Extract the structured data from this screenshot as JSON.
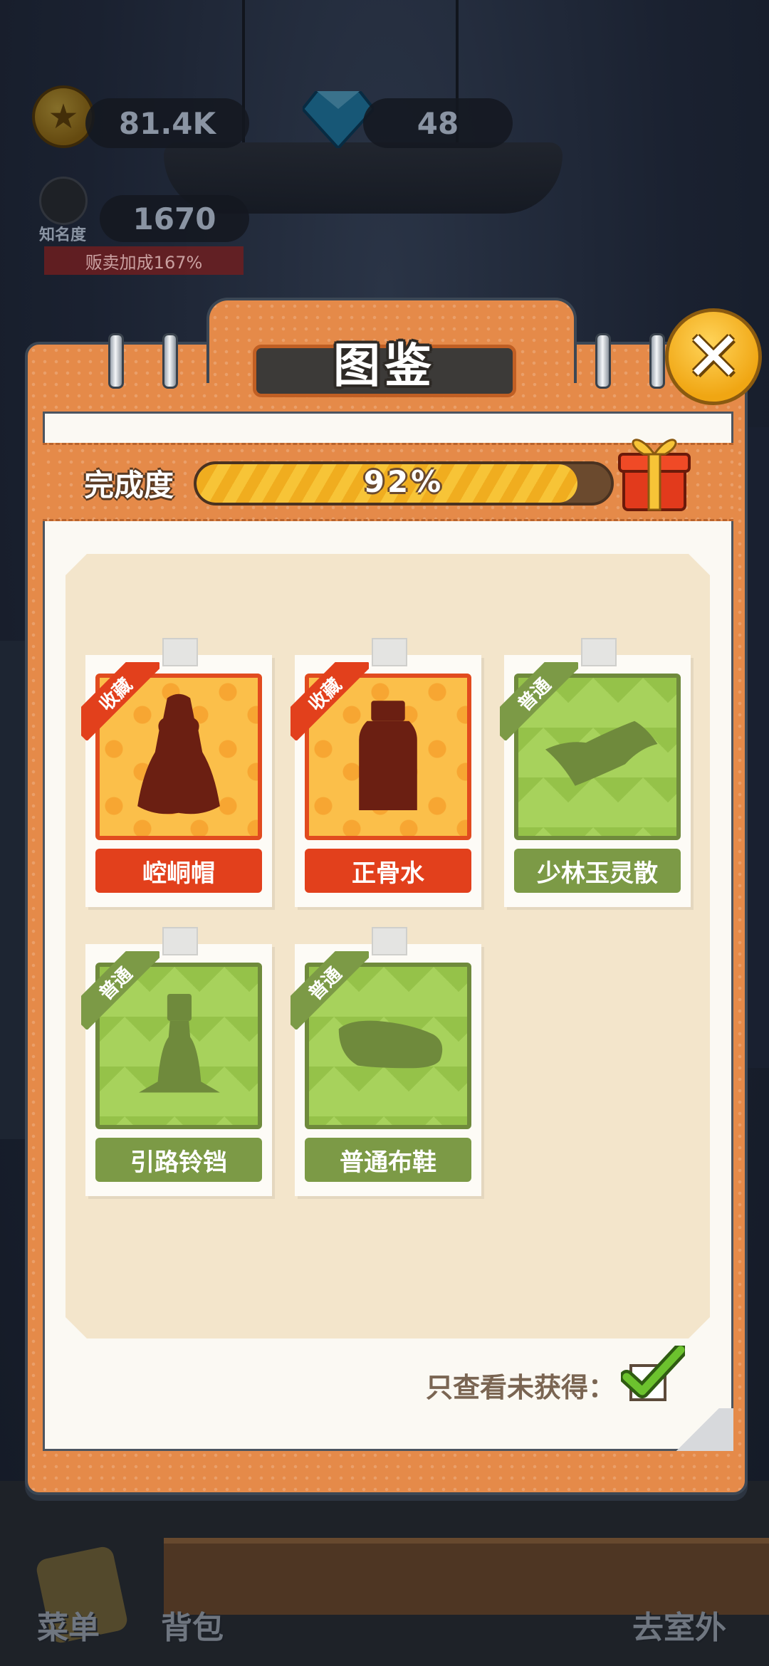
{
  "hud": {
    "coins": "81.4K",
    "gems": "48",
    "fame_value": "1670",
    "fame_label": "知名度",
    "sell_bonus": "贩卖加成167%"
  },
  "album": {
    "title": "图鉴",
    "progress_label": "完成度",
    "progress_value": "92%",
    "progress_fraction": 0.92,
    "items": [
      {
        "name": "崆峒帽",
        "tag": "收藏",
        "rarity": "rare",
        "icon": "hat-silhouette-icon"
      },
      {
        "name": "正骨水",
        "tag": "收藏",
        "rarity": "rare",
        "icon": "bottle-silhouette-icon"
      },
      {
        "name": "少林玉灵散",
        "tag": "普通",
        "rarity": "normal",
        "icon": "powder-pack-silhouette-icon"
      },
      {
        "name": "引路铃铛",
        "tag": "普通",
        "rarity": "normal",
        "icon": "bell-silhouette-icon"
      },
      {
        "name": "普通布鞋",
        "tag": "普通",
        "rarity": "normal",
        "icon": "shoe-silhouette-icon"
      }
    ],
    "filter_label": "只查看未获得：",
    "filter_checked": true
  },
  "nav": {
    "menu": "菜单",
    "bag": "背包",
    "outdoor": "去室外"
  },
  "colors": {
    "panel_orange": "#e58a49",
    "rare_red": "#e2401c",
    "normal_green": "#7c9a46",
    "progress_yellow": "#f7c437"
  }
}
